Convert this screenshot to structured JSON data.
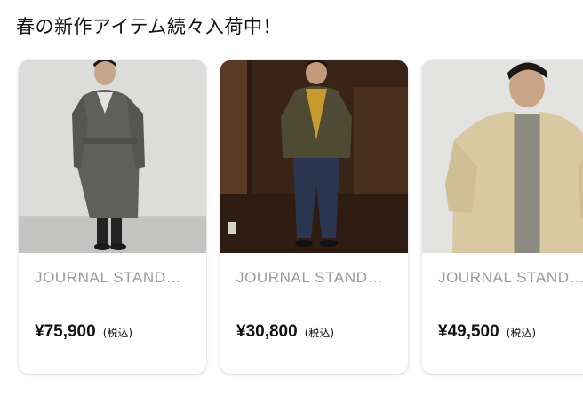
{
  "section": {
    "title": "春の新作アイテム続々入荷中！"
  },
  "products": [
    {
      "brand": "JOURNAL STANDARD",
      "price": "¥75,900",
      "tax_note": "(税込)",
      "image": "model-in-charcoal-trench-coat"
    },
    {
      "brand": "JOURNAL STANDARD",
      "price": "¥30,800",
      "tax_note": "(税込)",
      "image": "model-in-olive-jacket-and-denim"
    },
    {
      "brand": "JOURNAL STANDARD",
      "price": "¥49,500",
      "tax_note": "(税込)",
      "image": "model-in-beige-zip-jacket"
    }
  ]
}
